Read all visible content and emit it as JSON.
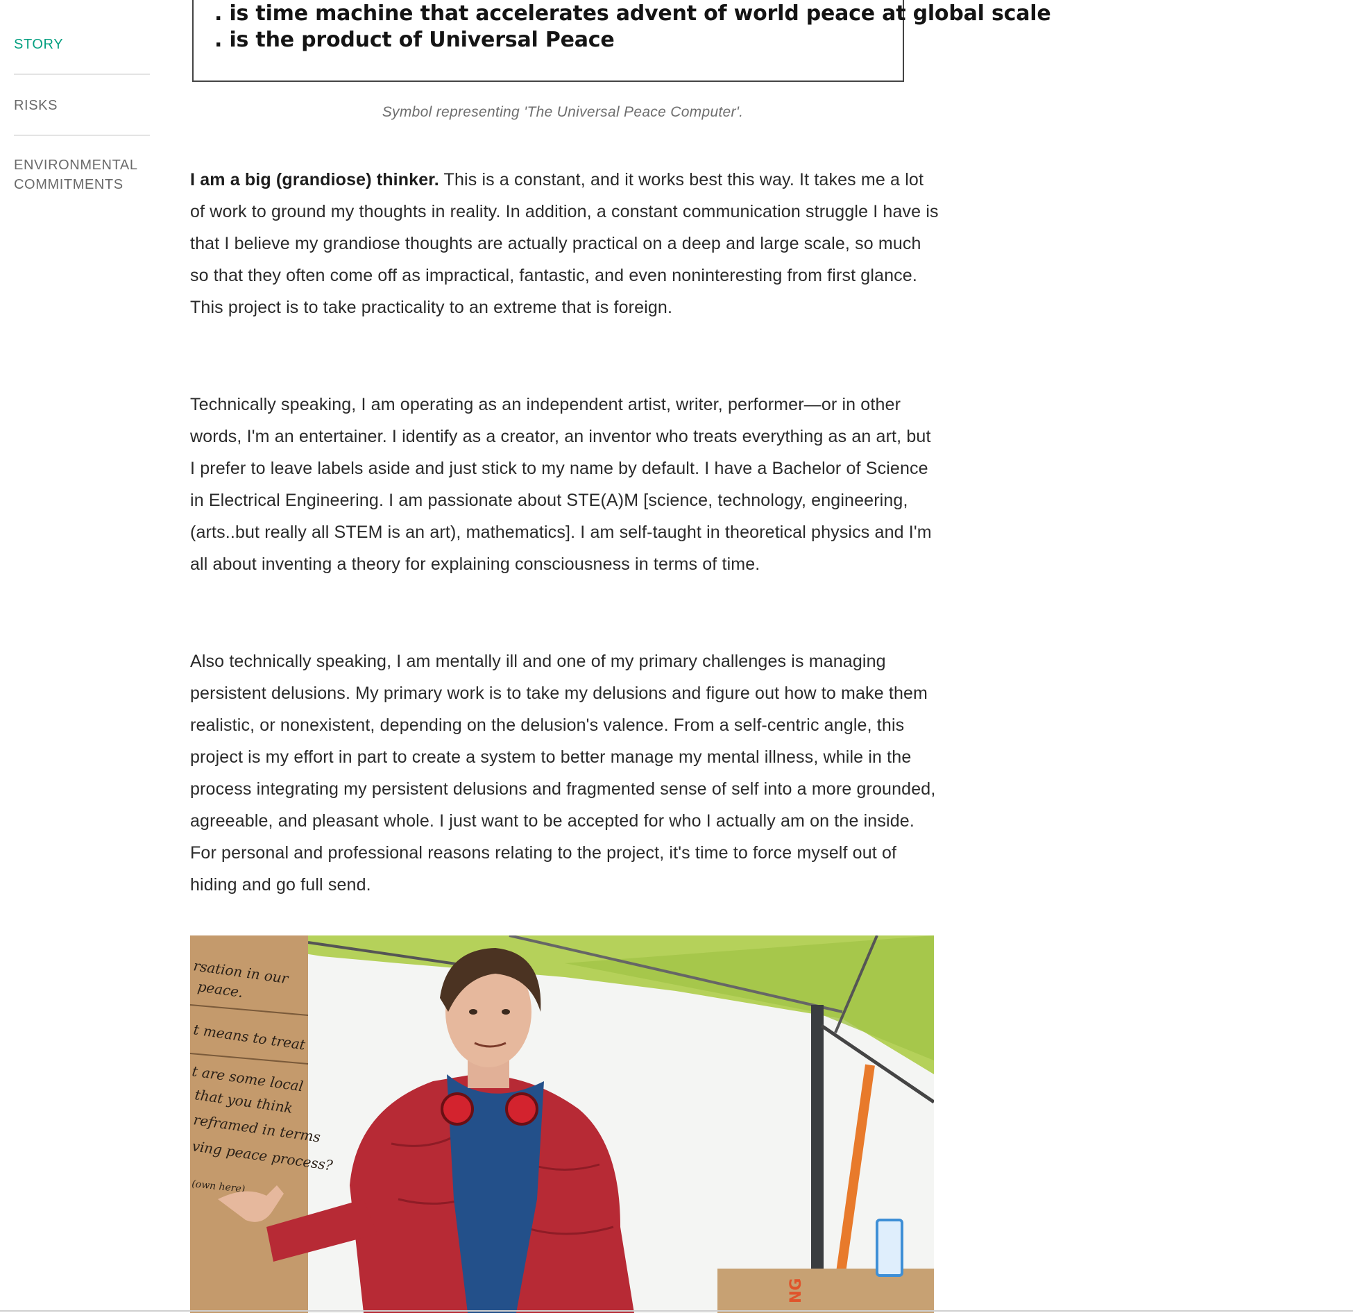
{
  "nav": {
    "items": [
      {
        "label": "STORY",
        "active": true
      },
      {
        "label": "RISKS",
        "active": false
      },
      {
        "label": "ENVIRONMENTAL COMMITMENTS",
        "active": false
      }
    ],
    "accent_color": "#05a081"
  },
  "symbol": {
    "lines": [
      ". is time machine that accelerates advent of world peace at global scale",
      ". is the product of Universal Peace"
    ],
    "caption": "Symbol representing 'The Universal Peace Computer'."
  },
  "article": {
    "p1_lead": "I am a big (grandiose) thinker.",
    "p1_rest": " This is a constant, and it works best this way. It takes me a lot of work to ground my thoughts in reality. In addition, a constant communication struggle I have is that I believe my grandiose thoughts are actually practical on a deep and large scale, so much so that they often come off as impractical, fantastic, and even noninteresting from first glance. This project is to take practicality to an extreme that is foreign.",
    "p2": "Technically speaking, I am operating as an independent artist, writer, performer—or in other words, I'm an entertainer. I identify as a creator, an inventor who treats everything as an art, but I prefer to leave labels aside and just stick to my name by default. I have a Bachelor of Science in Electrical Engineering. I am passionate about STE(A)M [science, technology, engineering, (arts..but really all STEM is an art), mathematics]. I am self-taught in theoretical physics and I'm all about inventing a theory for explaining consciousness in terms of time.",
    "p3": "Also technically speaking, I am mentally ill and one of my primary challenges is managing persistent delusions. My primary work is to take my delusions and figure out how to make them realistic, or nonexistent, depending on the delusion's valence. From a self-centric angle, this project is my effort in part to create a system to better manage my mental illness, while in the process integrating my persistent delusions and fragmented sense of self into a more grounded, agreeable, and pleasant whole. I just want to be accepted for who I actually am on the inside. For personal and professional reasons relating to the project, it's time to force myself out of hiding and go full send."
  },
  "photo": {
    "sign_text": [
      "rsation in our",
      "peace.",
      "t means to treat",
      "t are some local",
      "that you think",
      "reframed in terms",
      "ving peace process?",
      "(own here)"
    ],
    "box_text": "NG"
  }
}
